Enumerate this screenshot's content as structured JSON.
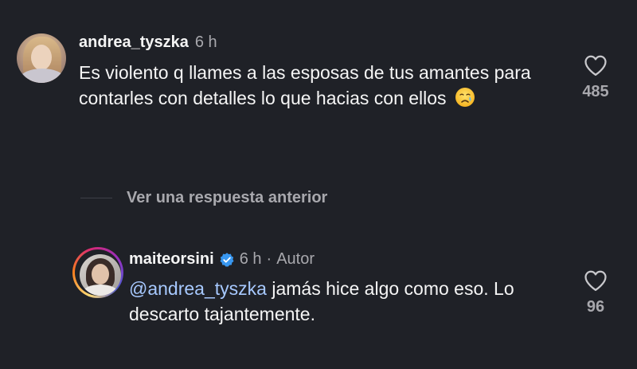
{
  "comments": [
    {
      "username": "andrea_tyszka",
      "time": "6 h",
      "text": "Es violento q llames a las esposas de tus amantes para contarles con detalles lo que hacias con ellos",
      "emoji": "crying-face-icon",
      "likes": "485"
    }
  ],
  "replies_toggle": {
    "label": "Ver una respuesta anterior"
  },
  "reply": {
    "username": "maiteorsini",
    "verified_icon": "verified-badge-icon",
    "time": "6 h",
    "separator": "·",
    "author_label": "Autor",
    "mention": "@andrea_tyszka",
    "text": " jamás hice algo como eso. Lo descarto tajantemente.",
    "likes": "96"
  },
  "colors": {
    "background": "#1f2127",
    "text": "#f5f5f5",
    "muted": "#a8a8ad",
    "mention": "#a7c9ff",
    "verified": "#3897f0"
  }
}
